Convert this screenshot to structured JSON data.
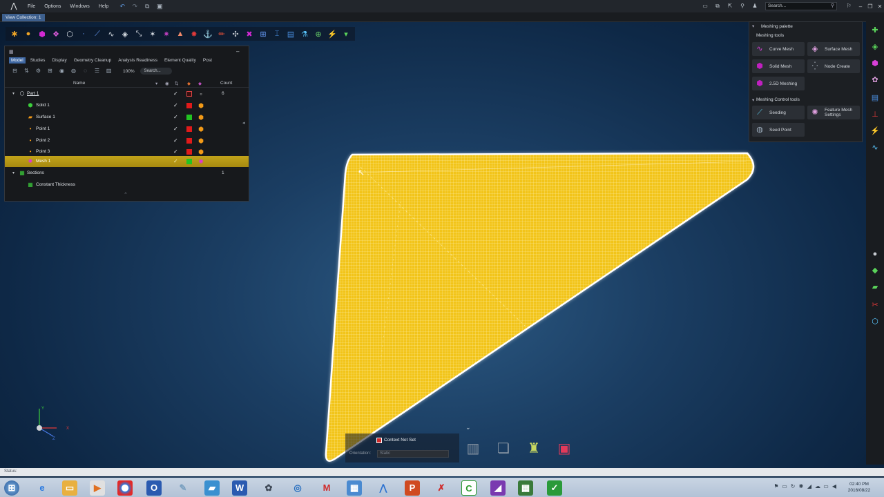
{
  "menubar": {
    "menus": [
      "File",
      "Options",
      "Windows",
      "Help"
    ],
    "search_placeholder": "Search..."
  },
  "view_collection": "View Collection: 1",
  "browser": {
    "tabs": [
      "Model",
      "Studies",
      "Display",
      "Geometry Cleanup",
      "Analysis Readiness",
      "Element Quality",
      "Post"
    ],
    "active_tab": "Model",
    "zoom": "100%",
    "search_placeholder": "Search...",
    "columns": {
      "name": "Name",
      "count": "Count"
    },
    "rows": [
      {
        "label": "Part 1",
        "count": "6",
        "color": "",
        "icon": "part-icon"
      },
      {
        "label": "Solid 1",
        "count": "",
        "color": "#e01a1a",
        "icon": "solid-icon"
      },
      {
        "label": "Surface 1",
        "count": "",
        "color": "#22c322",
        "icon": "surface-icon"
      },
      {
        "label": "Point 1",
        "count": "",
        "color": "#e01a1a",
        "icon": "point-icon"
      },
      {
        "label": "Point 2",
        "count": "",
        "color": "#e01a1a",
        "icon": "point-icon"
      },
      {
        "label": "Point 3",
        "count": "",
        "color": "#e01a1a",
        "icon": "point-icon"
      },
      {
        "label": "Mesh 1",
        "count": "",
        "color": "#22c322",
        "icon": "mesh-icon"
      },
      {
        "label": "Sections",
        "count": "1",
        "color": "",
        "icon": "sections-icon"
      },
      {
        "label": "Constant Thickness",
        "count": "",
        "color": "",
        "icon": "thickness-icon"
      }
    ]
  },
  "palette": {
    "title": "Meshing palette",
    "meshing_tools": "Meshing tools",
    "buttons": [
      "Curve Mesh",
      "Surface Mesh",
      "Solid Mesh",
      "Node Create",
      "2.5D Meshing"
    ],
    "control_title": "Meshing Control tools",
    "control_buttons": [
      "Seeding",
      "Feature Mesh Settings",
      "Seed Point"
    ]
  },
  "context": {
    "label": "Context Not Set",
    "orientation_label": "Orientation:",
    "orientation_value": "Static"
  },
  "status": "Status:",
  "clock": {
    "time": "02:40 PM",
    "date": "2016/08/22"
  },
  "colors": {
    "mesh": "#f2c419",
    "selection": "#b79a16",
    "accent": "#3f68a3"
  }
}
